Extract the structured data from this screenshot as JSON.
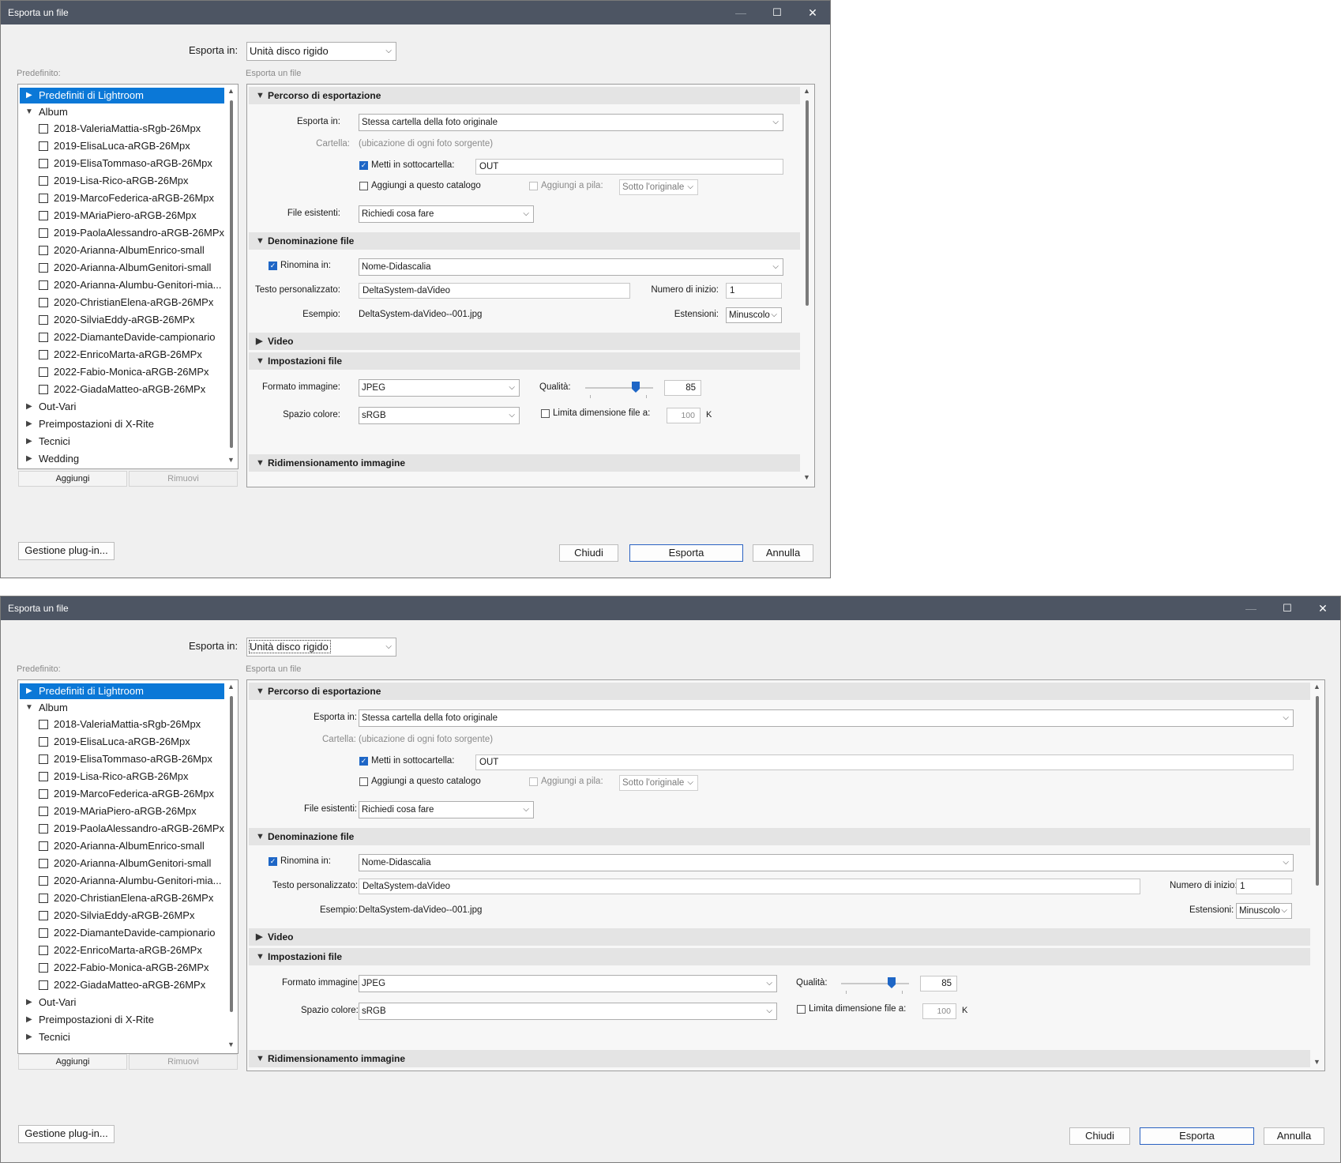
{
  "window": {
    "title": "Esporta un file",
    "minimize_glyph": "—",
    "maximize_glyph": "☐",
    "close_glyph": "✕"
  },
  "top": {
    "export_to_label": "Esporta in:",
    "export_to_value": "Unità disco rigido"
  },
  "presets": {
    "label": "Predefinito:",
    "groups": [
      {
        "label": "Predefiniti di Lightroom",
        "expanded": false,
        "selected": true
      },
      {
        "label": "Album",
        "expanded": true
      }
    ],
    "album_items": [
      "2018-ValeriaMattia-sRgb-26Mpx",
      "2019-ElisaLuca-aRGB-26Mpx",
      "2019-ElisaTommaso-aRGB-26Mpx",
      "2019-Lisa-Rico-aRGB-26Mpx",
      "2019-MarcoFederica-aRGB-26Mpx",
      "2019-MAriaPiero-aRGB-26Mpx",
      "2019-PaolaAlessandro-aRGB-26MPx",
      "2020-Arianna-AlbumEnrico-small",
      "2020-Arianna-AlbumGenitori-small",
      "2020-Arianna-Alumbu-Genitori-mia...",
      "2020-ChristianElena-aRGB-26MPx",
      "2020-SilviaEddy-aRGB-26MPx",
      "2022-DiamanteDavide-campionario",
      "2022-EnricoMarta-aRGB-26MPx",
      "2022-Fabio-Monica-aRGB-26MPx",
      "2022-GiadaMatteo-aRGB-26MPx"
    ],
    "more_groups": [
      "Out-Vari",
      "Preimpostazioni di X-Rite",
      "Tecnici",
      "Wedding"
    ],
    "add_button": "Aggiungi",
    "remove_button": "Rimuovi"
  },
  "export_panel": {
    "label": "Esporta un file",
    "location": {
      "title": "Percorso di esportazione",
      "export_to_label": "Esporta in:",
      "export_to_value": "Stessa cartella della foto originale",
      "folder_label": "Cartella:",
      "folder_value": "(ubicazione di ogni foto sorgente)",
      "subfolder_label": "Metti in sottocartella:",
      "subfolder_value": "OUT",
      "add_catalog_label": "Aggiungi a questo catalogo",
      "add_stack_label": "Aggiungi a pila:",
      "stack_value": "Sotto l'originale",
      "existing_label": "File esistenti:",
      "existing_value": "Richiedi cosa fare"
    },
    "naming": {
      "title": "Denominazione file",
      "rename_label": "Rinomina in:",
      "rename_value": "Nome-Didascalia",
      "custom_text_label": "Testo personalizzato:",
      "custom_text_value": "DeltaSystem-daVideo",
      "start_number_label": "Numero di inizio:",
      "start_number_value": "1",
      "example_label": "Esempio:",
      "example_value": "DeltaSystem-daVideo--001.jpg",
      "extensions_label": "Estensioni:",
      "extensions_value": "Minuscolo"
    },
    "video": {
      "title": "Video"
    },
    "file_settings": {
      "title": "Impostazioni file",
      "format_label": "Formato immagine:",
      "format_value": "JPEG",
      "quality_label": "Qualità:",
      "quality_value": "85",
      "quality_fraction": 0.85,
      "color_space_label": "Spazio colore:",
      "color_space_value": "sRGB",
      "limit_size_label": "Limita dimensione file a:",
      "limit_size_value": "100",
      "limit_size_unit": "K"
    },
    "resize": {
      "title": "Ridimensionamento immagine"
    }
  },
  "footer": {
    "plugin_button": "Gestione plug-in...",
    "close_button": "Chiudi",
    "export_button": "Esporta",
    "cancel_button": "Annulla"
  },
  "colors": {
    "titlebar": "#4d5563",
    "selection": "#0b78d7",
    "accent": "#1e66c6"
  },
  "icons": [
    "minimize-icon",
    "maximize-icon",
    "close-icon",
    "chevron-down-icon",
    "triangle-right-icon",
    "triangle-down-icon",
    "checkmark-icon",
    "scroll-up-icon",
    "scroll-down-icon"
  ]
}
